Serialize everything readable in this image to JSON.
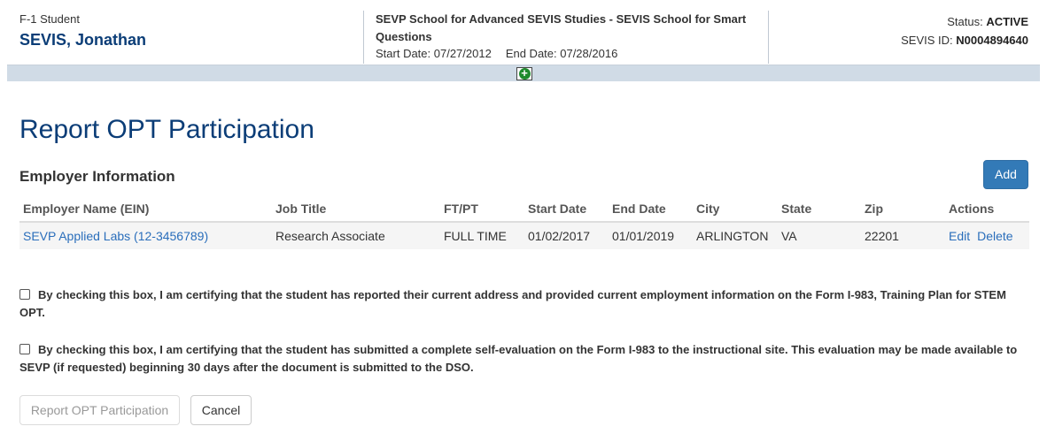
{
  "header": {
    "student_type": "F-1 Student",
    "student_name": "SEVIS, Jonathan",
    "school_name": "SEVP School for Advanced SEVIS Studies - SEVIS School for Smart Questions",
    "start_date": "Start Date: 07/27/2012",
    "end_date": "End Date: 07/28/2016",
    "status_label": "Status:",
    "status_value": "ACTIVE",
    "sevis_id_label": "SEVIS ID:",
    "sevis_id_value": "N0004894640"
  },
  "page": {
    "title": "Report OPT Participation",
    "section_title": "Employer Information",
    "add_label": "Add"
  },
  "table": {
    "headers": [
      "Employer Name (EIN)",
      "Job Title",
      "FT/PT",
      "Start Date",
      "End Date",
      "City",
      "State",
      "Zip",
      "Actions"
    ],
    "rows": [
      {
        "employer": "SEVP Applied Labs (12-3456789)",
        "job_title": "Research Associate",
        "ftpt": "FULL TIME",
        "start_date": "01/02/2017",
        "end_date": "01/01/2019",
        "city": "ARLINGTON",
        "state": "VA",
        "zip": "22201",
        "edit_label": "Edit",
        "delete_label": "Delete"
      }
    ]
  },
  "certifications": [
    {
      "text": "By checking this box, I am certifying that the student has reported their current address and provided current employment information on the Form I-983, Training Plan for STEM OPT.",
      "checked": false
    },
    {
      "text": "By checking this box, I am certifying that the student has submitted a complete self-evaluation on the Form I-983 to the instructional site. This evaluation may be made available to SEVP (if requested) beginning 30 days after the document is submitted to the DSO.",
      "checked": false
    }
  ],
  "buttons": {
    "report_label": "Report OPT Participation",
    "cancel_label": "Cancel"
  },
  "colors": {
    "brand": "#0b3d77",
    "primary_button": "#337ab7",
    "link": "#2a6ebb",
    "expand_icon": "#1e8a2c"
  }
}
